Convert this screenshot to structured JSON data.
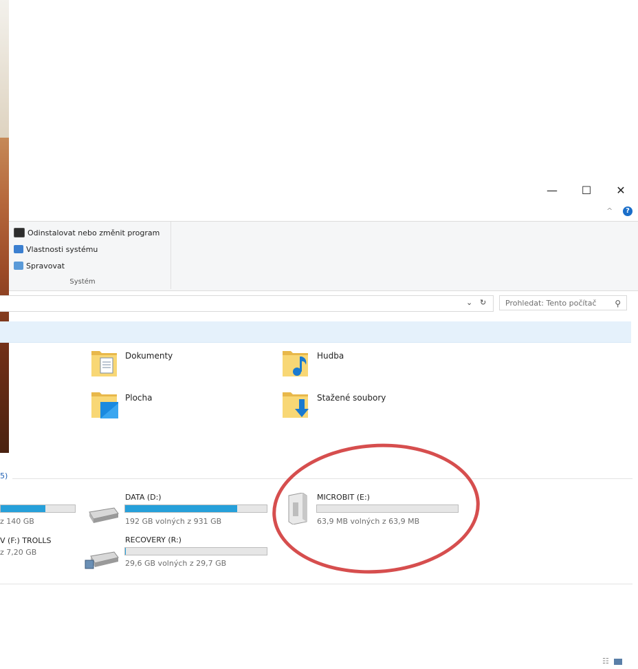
{
  "window_controls": {
    "minimize": "—",
    "maximize": "☐",
    "close": "✕"
  },
  "ribbon": {
    "items": [
      {
        "label": "Odinstalovat nebo změnit program",
        "icon": "uninstall-program-icon"
      },
      {
        "label": "Vlastnosti systému",
        "icon": "system-properties-icon"
      },
      {
        "label": "Spravovat",
        "icon": "manage-computer-icon"
      }
    ],
    "group": "Systém"
  },
  "addressbar": {
    "search_placeholder": "Prohledat: Tento počítač"
  },
  "folders": [
    {
      "name": "Dokumenty",
      "icon": "documents-folder-icon"
    },
    {
      "name": "Hudba",
      "icon": "music-folder-icon"
    },
    {
      "name": "Plocha",
      "icon": "desktop-folder-icon"
    },
    {
      "name": "Stažené soubory",
      "icon": "downloads-folder-icon"
    }
  ],
  "devices_section_label": "5)",
  "drives": [
    {
      "name": "DATA (D:)",
      "size": "192 GB volných z 931 GB",
      "used_fraction": 0.79,
      "icon": "hard-drive-icon"
    },
    {
      "name": "RECOVERY (R:)",
      "size": "29,6 GB volných z 29,7 GB",
      "used_fraction": 0.005,
      "icon": "hard-drive-icon"
    },
    {
      "name": "MICROBIT (E:)",
      "size": "63,9 MB volných z 63,9 MB",
      "used_fraction": 0.0,
      "icon": "removable-drive-icon"
    }
  ],
  "partial_drives": [
    {
      "name": "",
      "size": "z 140 GB",
      "used_fraction": 0.55
    },
    {
      "name": "V (F:) TROLLS",
      "size": "z 7,20 GB",
      "used_fraction": null
    }
  ],
  "colors": {
    "accent": "#26a0da",
    "annotation": "#d23b3b",
    "highlight": "#e5f1fb"
  }
}
